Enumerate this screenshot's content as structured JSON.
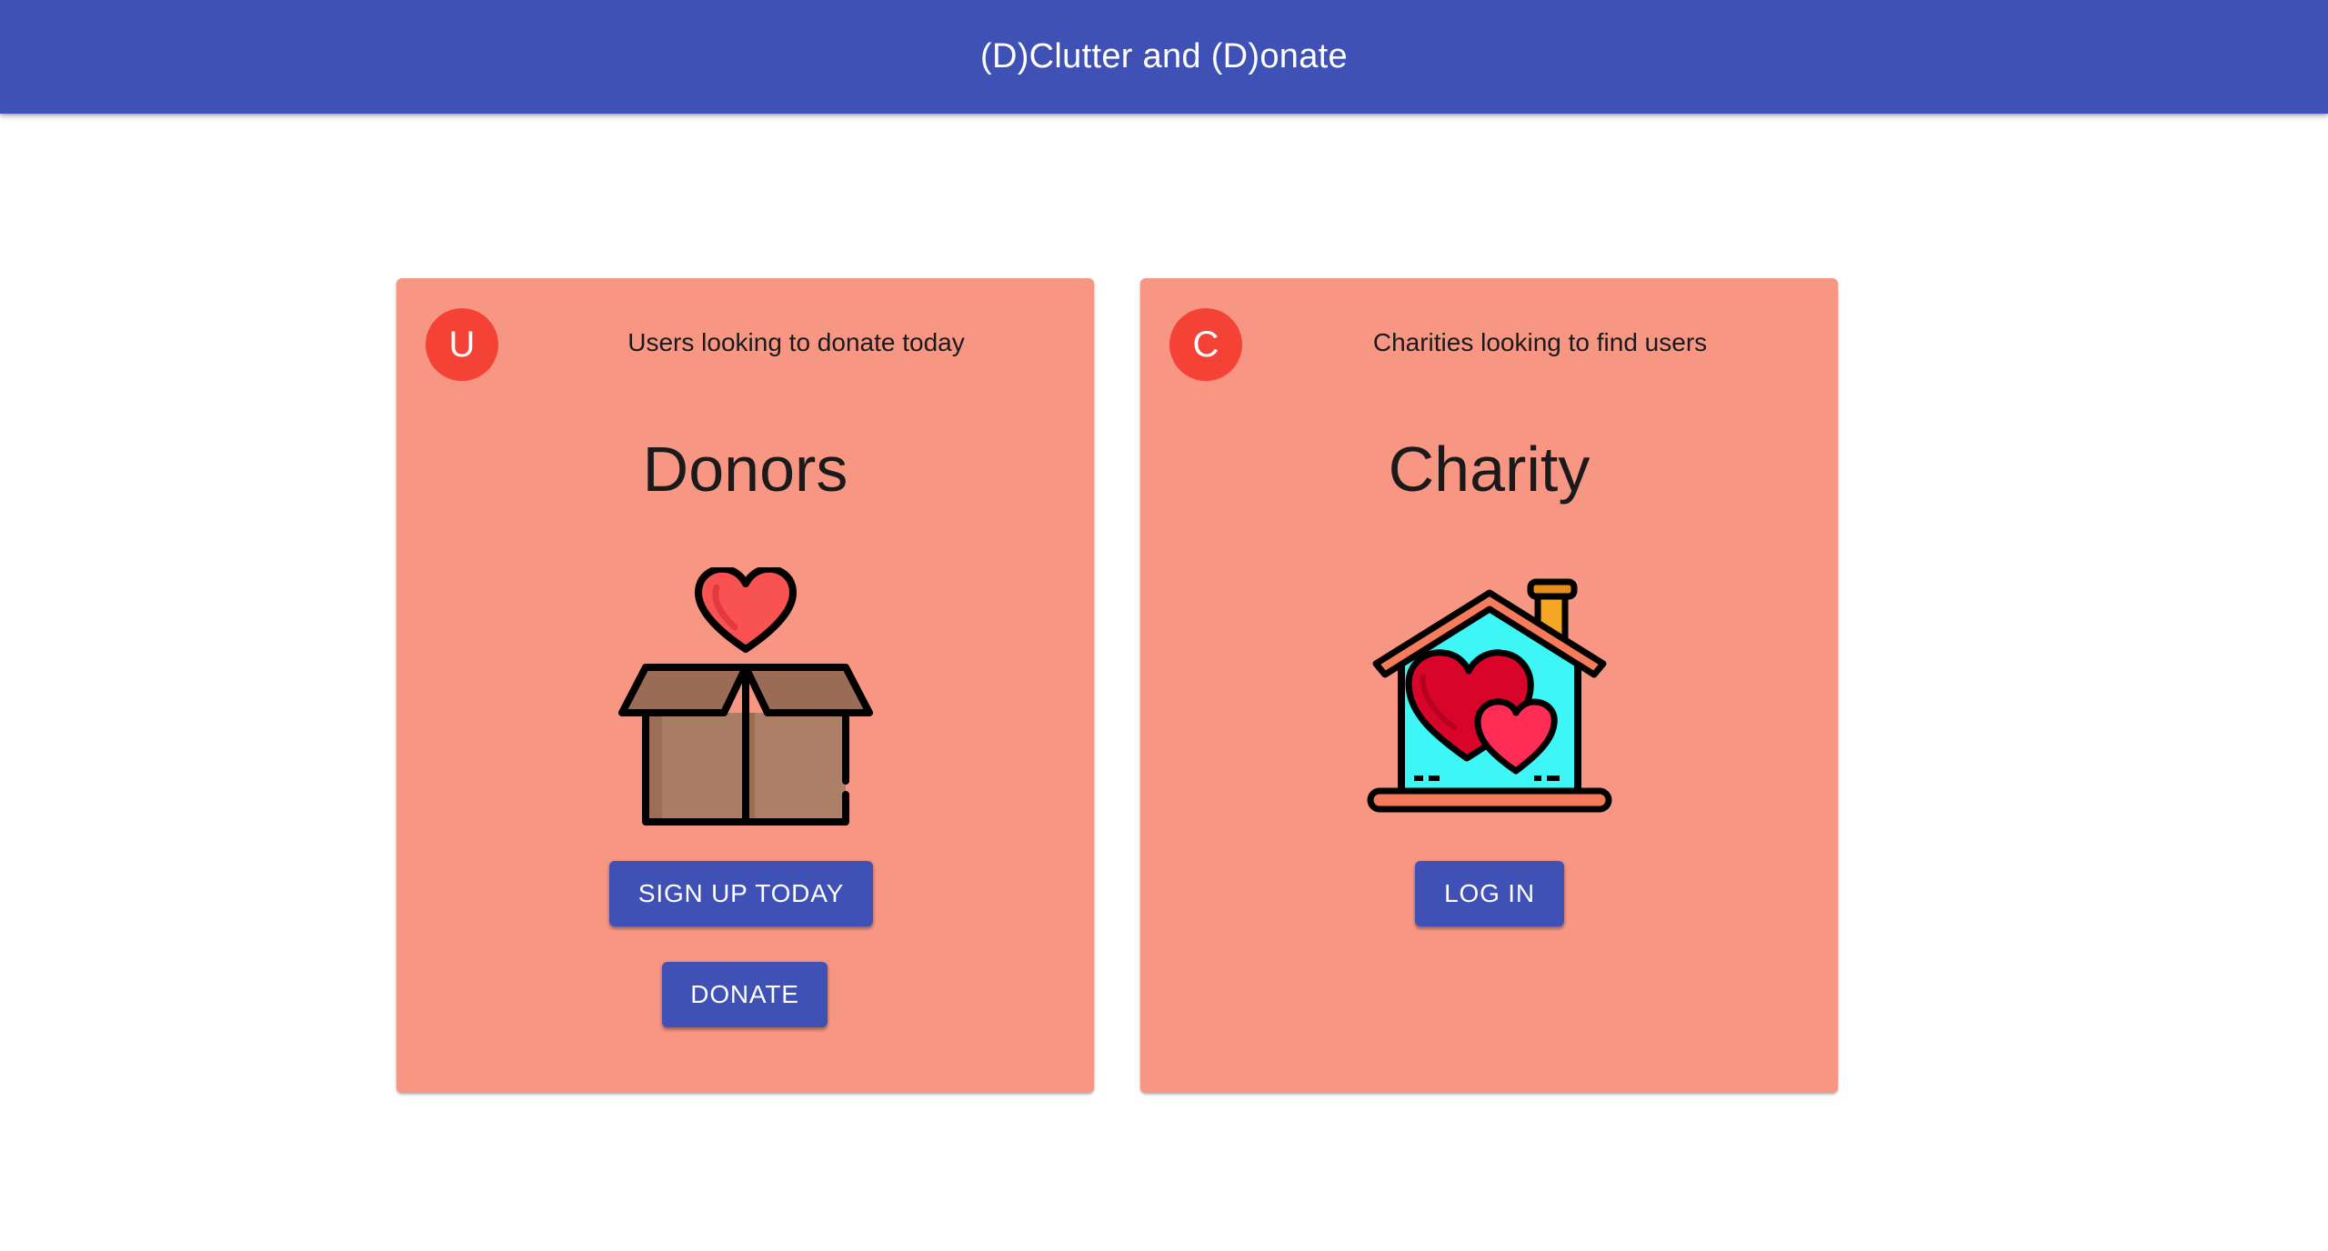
{
  "app": {
    "title": "(D)Clutter and (D)onate",
    "accent_color": "#3f51b5",
    "card_color": "#f89684",
    "avatar_color": "#f44336"
  },
  "cards": [
    {
      "avatar_letter": "U",
      "subheader": "Users looking to donate today",
      "title": "Donors",
      "icon": "gift-box-heart-icon",
      "buttons": [
        "SIGN UP TODAY",
        "DONATE"
      ]
    },
    {
      "avatar_letter": "C",
      "subheader": "Charities looking to find users",
      "title": "Charity",
      "icon": "house-hearts-icon",
      "buttons": [
        "LOG IN"
      ]
    }
  ]
}
